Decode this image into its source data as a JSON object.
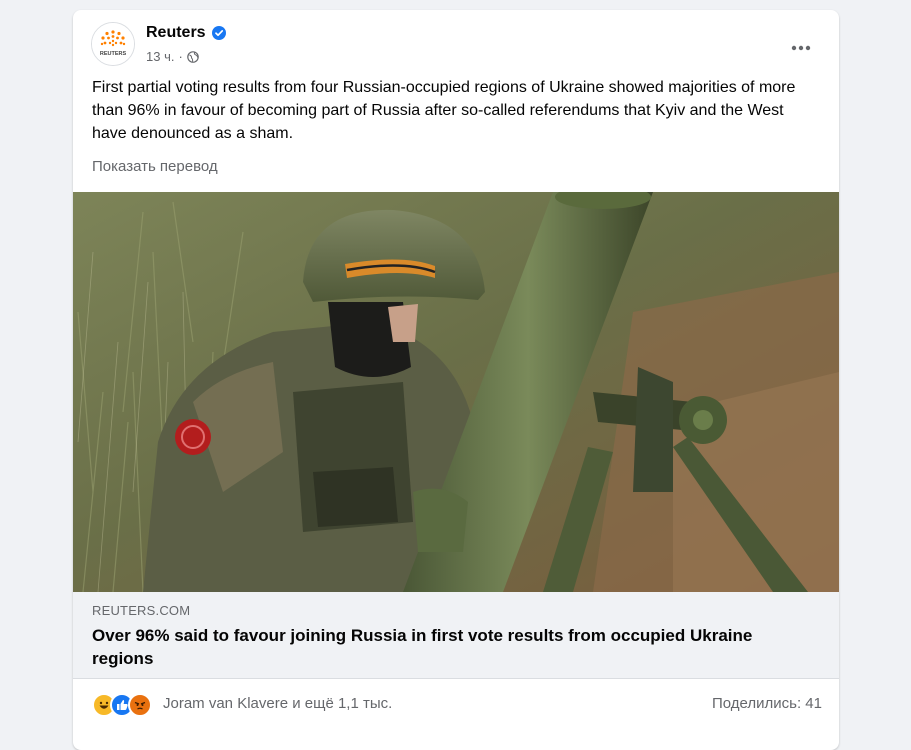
{
  "post": {
    "page_name": "Reuters",
    "avatar_text": "REUTERS",
    "time": "13 ч.",
    "visibility_icon": "globe-icon",
    "more_icon": "more-horizontal-icon",
    "text": "First partial voting results from four Russian-occupied regions of Ukraine showed majorities of more than 96% in favour of becoming part of Russia after so-called referendums that Kyiv and the West have denounced as a sham.",
    "translate_label": "Показать перевод"
  },
  "link_preview": {
    "domain": "REUTERS.COM",
    "title": "Over 96% said to favour joining Russia in first vote results from occupied Ukraine regions"
  },
  "footer": {
    "reaction_icons": [
      "haha-icon",
      "like-icon",
      "angry-icon"
    ],
    "reactions_text": "Joram van Klavere и ещё 1,1 тыс.",
    "shares_text": "Поделились: 41"
  },
  "colors": {
    "accent": "#1877f2",
    "secondary_text": "#65676b",
    "background": "#f0f2f5"
  }
}
